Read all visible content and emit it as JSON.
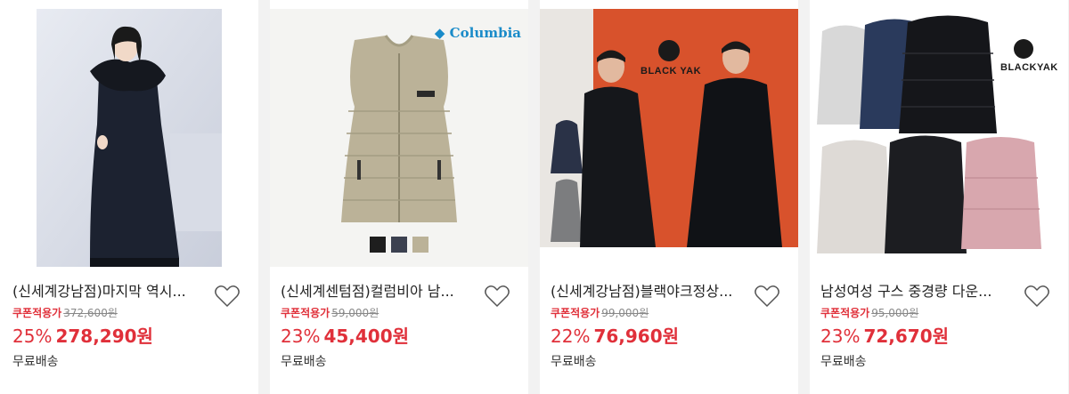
{
  "products": [
    {
      "title": "(신세계강남점)마지막 역시...",
      "coupon_label": "쿠폰적용가",
      "original_price": "372,600원",
      "discount": "25%",
      "price": "278,290원",
      "shipping": "무료배송",
      "image_desc": "woman-long-black-coat-fur-hood"
    },
    {
      "title": "(신세계센텀점)컬럼비아 남...",
      "coupon_label": "쿠폰적용가",
      "original_price": "59,000원",
      "discount": "23%",
      "price": "45,400원",
      "shipping": "무료배송",
      "brand_logo": "Columbia",
      "image_desc": "beige-puffer-vest"
    },
    {
      "title": "(신세계강남점)블랙야크정상...",
      "coupon_label": "쿠폰적용가",
      "original_price": "99,000원",
      "discount": "22%",
      "price": "76,960원",
      "shipping": "무료배송",
      "brand_logo": "BLACK YAK",
      "image_desc": "men-black-long-parka"
    },
    {
      "title": "남성여성 구스 중경량 다운...",
      "coupon_label": "쿠폰적용가",
      "original_price": "95,000원",
      "discount": "23%",
      "price": "72,670원",
      "shipping": "무료배송",
      "brand_logo": "BLACKYAK",
      "image_desc": "down-jackets-collection"
    }
  ],
  "colors": {
    "accent": "#e0303a",
    "background": "#f2f2f2",
    "columbia_blue": "#1a8bc9",
    "orange_bg": "#d8522c"
  },
  "icons": {
    "wishlist": "heart-outline-icon"
  }
}
